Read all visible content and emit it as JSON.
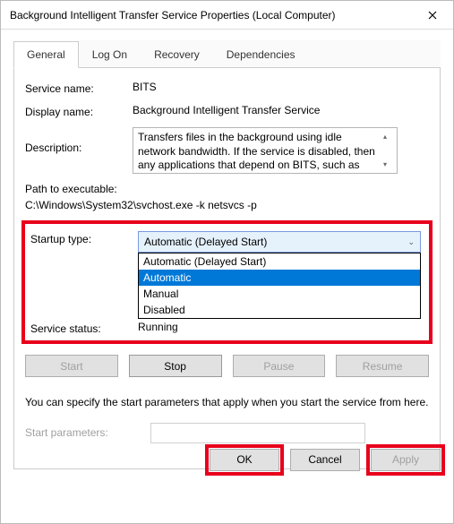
{
  "titlebar": {
    "title": "Background Intelligent Transfer Service Properties (Local Computer)"
  },
  "tabs": {
    "general": "General",
    "logon": "Log On",
    "recovery": "Recovery",
    "dependencies": "Dependencies"
  },
  "labels": {
    "service_name": "Service name:",
    "display_name": "Display name:",
    "description": "Description:",
    "path_to_exe": "Path to executable:",
    "startup_type": "Startup type:",
    "service_status": "Service status:",
    "start_parameters": "Start parameters:"
  },
  "values": {
    "service_name": "BITS",
    "display_name": "Background Intelligent Transfer Service",
    "description": "Transfers files in the background using idle network bandwidth. If the service is disabled, then any applications that depend on BITS, such as Windows",
    "path": "C:\\Windows\\System32\\svchost.exe -k netsvcs -p",
    "startup_selected": "Automatic (Delayed Start)",
    "service_status": "Running"
  },
  "startup_options": {
    "o0": "Automatic (Delayed Start)",
    "o1": "Automatic",
    "o2": "Manual",
    "o3": "Disabled"
  },
  "buttons": {
    "start": "Start",
    "stop": "Stop",
    "pause": "Pause",
    "resume": "Resume",
    "ok": "OK",
    "cancel": "Cancel",
    "apply": "Apply"
  },
  "note": "You can specify the start parameters that apply when you start the service from here."
}
